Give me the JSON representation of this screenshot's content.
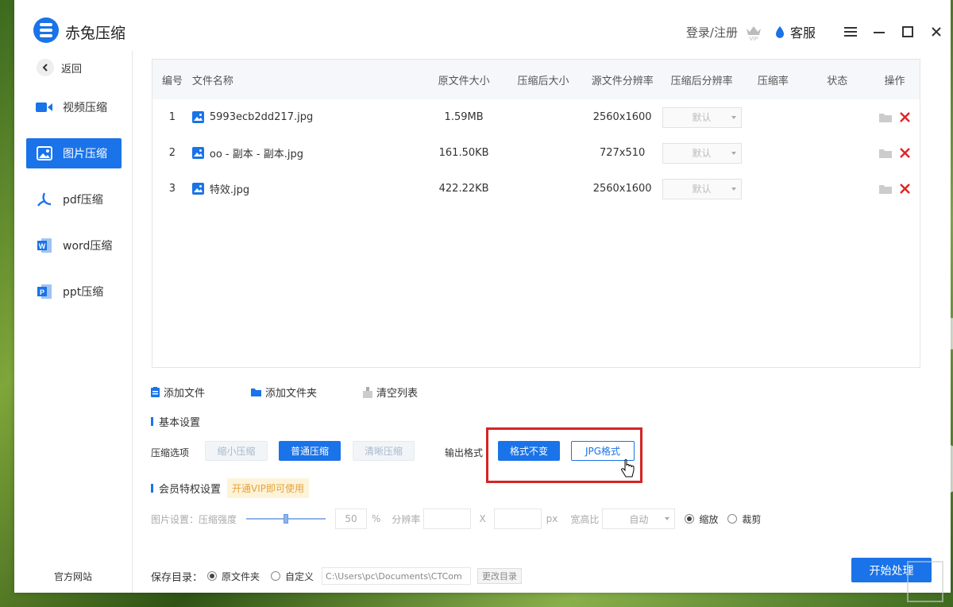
{
  "app": {
    "title": "赤兔压缩"
  },
  "titlebar": {
    "login": "登录/注册",
    "service": "客服"
  },
  "sidebar": {
    "back": "返回",
    "items": [
      {
        "label": "视频压缩",
        "icon": "video-icon"
      },
      {
        "label": "图片压缩",
        "icon": "image-icon"
      },
      {
        "label": "pdf压缩",
        "icon": "pdf-icon"
      },
      {
        "label": "word压缩",
        "icon": "word-icon"
      },
      {
        "label": "ppt压缩",
        "icon": "ppt-icon"
      }
    ],
    "site_link": "官方网站"
  },
  "table": {
    "headers": [
      "编号",
      "文件名称",
      "原文件大小",
      "压缩后大小",
      "源文件分辨率",
      "压缩后分辨率",
      "压缩率",
      "状态",
      "操作"
    ],
    "rows": [
      {
        "no": "1",
        "name": "5993ecb2dd217.jpg",
        "orig_size": "1.59MB",
        "comp_size": "",
        "resolution": "2560x1600",
        "comp_res": "默认",
        "rate": "",
        "status": ""
      },
      {
        "no": "2",
        "name": "oo - 副本 - 副本.jpg",
        "orig_size": "161.50KB",
        "comp_size": "",
        "resolution": "727x510",
        "comp_res": "默认",
        "rate": "",
        "status": ""
      },
      {
        "no": "3",
        "name": "特效.jpg",
        "orig_size": "422.22KB",
        "comp_size": "",
        "resolution": "2560x1600",
        "comp_res": "默认",
        "rate": "",
        "status": ""
      }
    ]
  },
  "toolbar": {
    "add_file": "添加文件",
    "add_folder": "添加文件夹",
    "clear": "清空列表"
  },
  "basic": {
    "title": "基本设置",
    "compress_label": "压缩选项",
    "opt_small": "缩小压缩",
    "opt_normal": "普通压缩",
    "opt_clear": "清晰压缩",
    "output_label": "输出格式",
    "fmt_keep": "格式不变",
    "fmt_jpg": "JPG格式"
  },
  "vip": {
    "title": "会员特权设置",
    "tag": "开通VIP即可使用",
    "img_label": "图片设置：压缩强度",
    "strength": "50",
    "percent": "%",
    "res_label": "分辨率",
    "x": "X",
    "px": "px",
    "ratio_label": "宽高比",
    "ratio_value": "自动",
    "scale": "缩放",
    "crop": "裁剪",
    "strength_fraction": 0.5
  },
  "save": {
    "label": "保存目录：",
    "original": "原文件夹",
    "custom": "自定义",
    "path": "C:\\Users\\pc\\Documents\\CTCom",
    "change": "更改目录"
  },
  "start": "开始处理",
  "colors": {
    "accent": "#1a73e8",
    "danger": "#e02424",
    "highlight": "#d52424",
    "vip": "#e6a23c"
  }
}
